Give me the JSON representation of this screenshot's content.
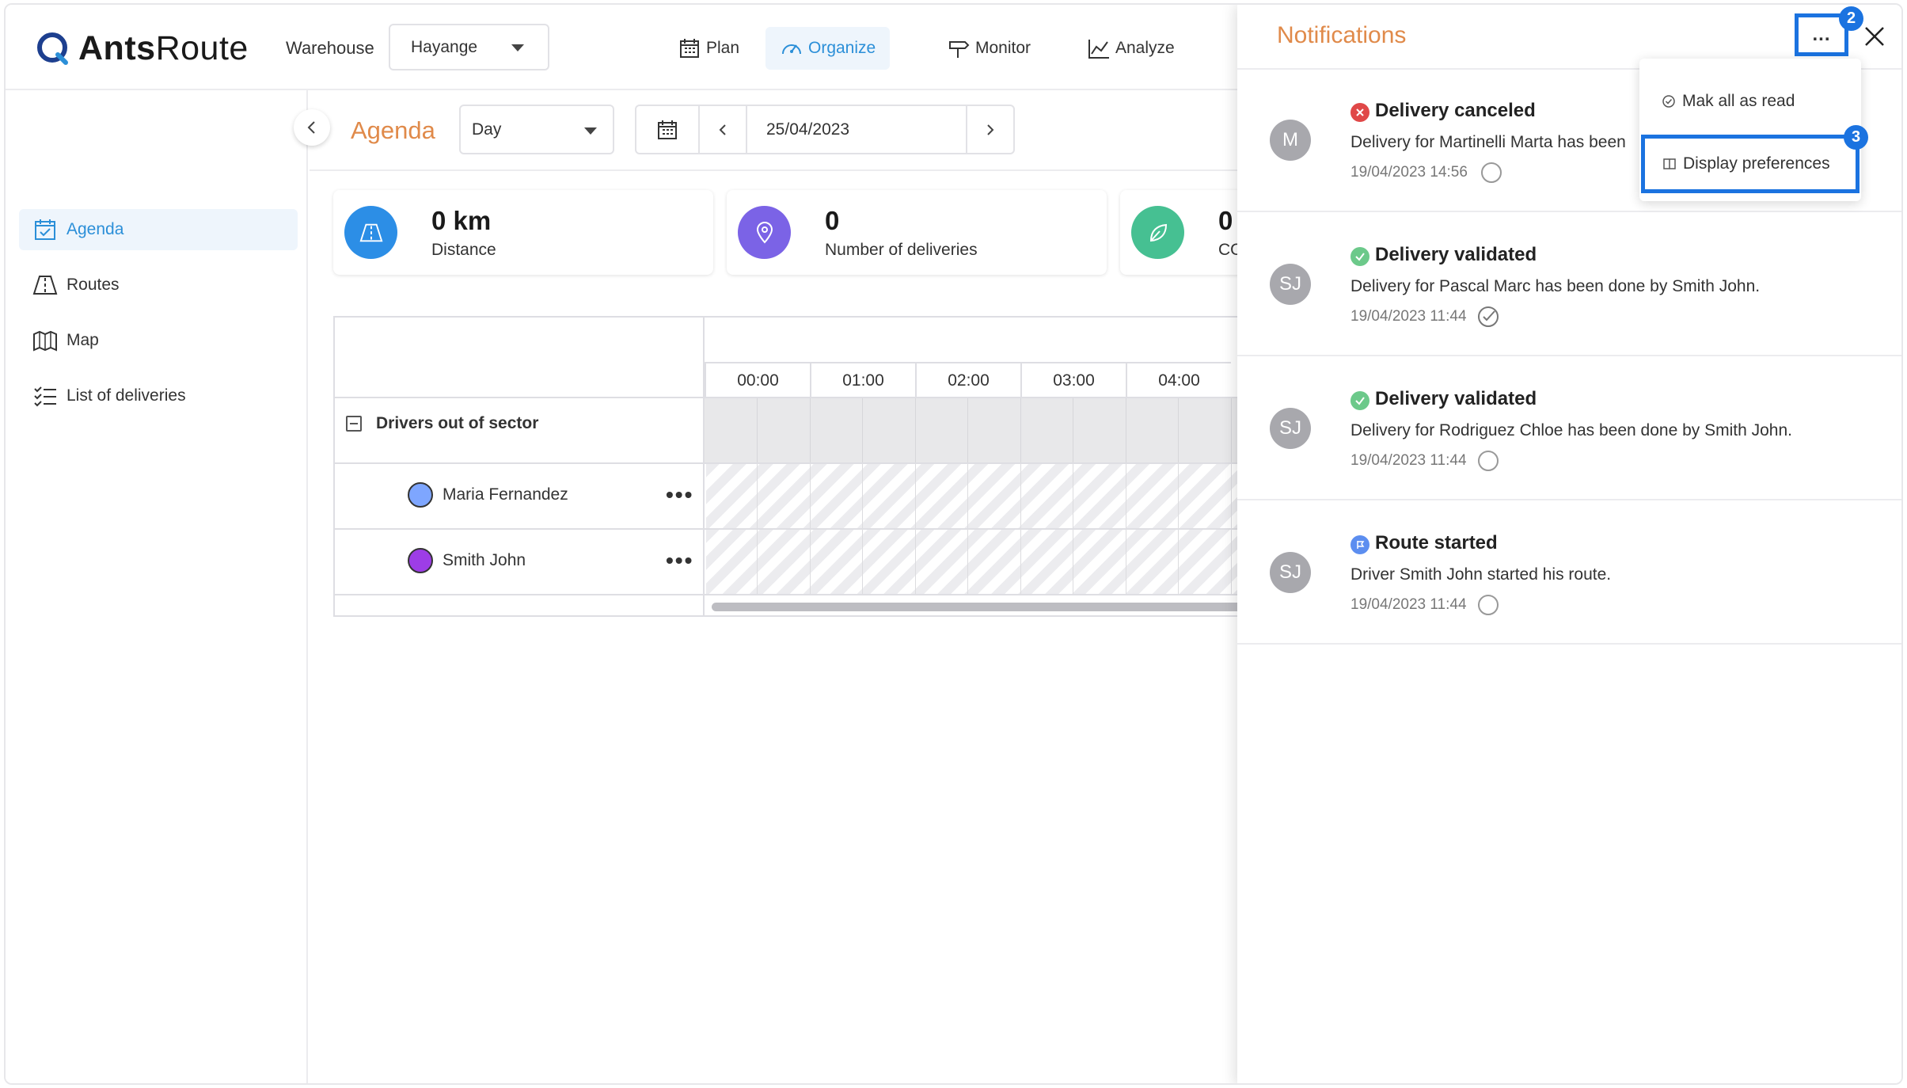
{
  "brand": {
    "name_bold": "Ants",
    "name_regular": "Route"
  },
  "header": {
    "warehouse_label": "Warehouse",
    "warehouse_value": "Hayange",
    "nav": [
      {
        "label": "Plan",
        "icon": "calendar-grid-icon"
      },
      {
        "label": "Organize",
        "icon": "gauge-icon",
        "active": true
      },
      {
        "label": "Monitor",
        "icon": "signpost-icon"
      },
      {
        "label": "Analyze",
        "icon": "chart-icon"
      }
    ]
  },
  "sidebar": {
    "items": [
      {
        "label": "Agenda",
        "icon": "calendar-check-icon",
        "active": true
      },
      {
        "label": "Routes",
        "icon": "road-icon"
      },
      {
        "label": "Map",
        "icon": "map-pin-icon"
      },
      {
        "label": "List of deliveries",
        "icon": "checklist-icon"
      }
    ]
  },
  "main": {
    "title": "Agenda",
    "view": "Day",
    "date": "25/04/2023",
    "stats": [
      {
        "value": "0 km",
        "label": "Distance",
        "color": "#2c8ee6",
        "icon": "road-icon"
      },
      {
        "value": "0",
        "label": "Number of deliveries",
        "color": "#7b63e6",
        "icon": "location-pin-icon"
      },
      {
        "value": "0",
        "label": "CO",
        "color": "#46c092",
        "icon": "leaf-icon"
      }
    ],
    "timeline": {
      "hours": [
        "00:00",
        "01:00",
        "02:00",
        "03:00",
        "04:00"
      ],
      "group_label": "Drivers out of sector",
      "drivers": [
        {
          "name": "Maria Fernandez",
          "color": "#7ea6ff"
        },
        {
          "name": "Smith John",
          "color": "#9d3de6"
        }
      ]
    }
  },
  "notifications": {
    "title": "Notifications",
    "menu_button": "...",
    "menu": {
      "mark_all": "Mak all as read",
      "display_prefs": "Display preferences"
    },
    "badges": {
      "menu_button": "2",
      "display_prefs": "3"
    },
    "accent": "#1b73e0",
    "items": [
      {
        "avatar": "M",
        "status": "canceled",
        "status_color": "#e04848",
        "title": "Delivery canceled",
        "body": "Delivery for Martinelli Marta has been",
        "time": "19/04/2023 14:56",
        "read": false
      },
      {
        "avatar": "SJ",
        "status": "validated",
        "status_color": "#6cc98a",
        "title": "Delivery validated",
        "body": "Delivery for Pascal Marc has been done by Smith John.",
        "time": "19/04/2023 11:44",
        "read": true
      },
      {
        "avatar": "SJ",
        "status": "validated",
        "status_color": "#6cc98a",
        "title": "Delivery validated",
        "body": "Delivery for Rodriguez Chloe has been done by Smith John.",
        "time": "19/04/2023 11:44",
        "read": false
      },
      {
        "avatar": "SJ",
        "status": "route",
        "status_color": "#5c8ef0",
        "title": "Route started",
        "body": "Driver Smith John started his route.",
        "time": "19/04/2023 11:44",
        "read": false
      }
    ]
  }
}
